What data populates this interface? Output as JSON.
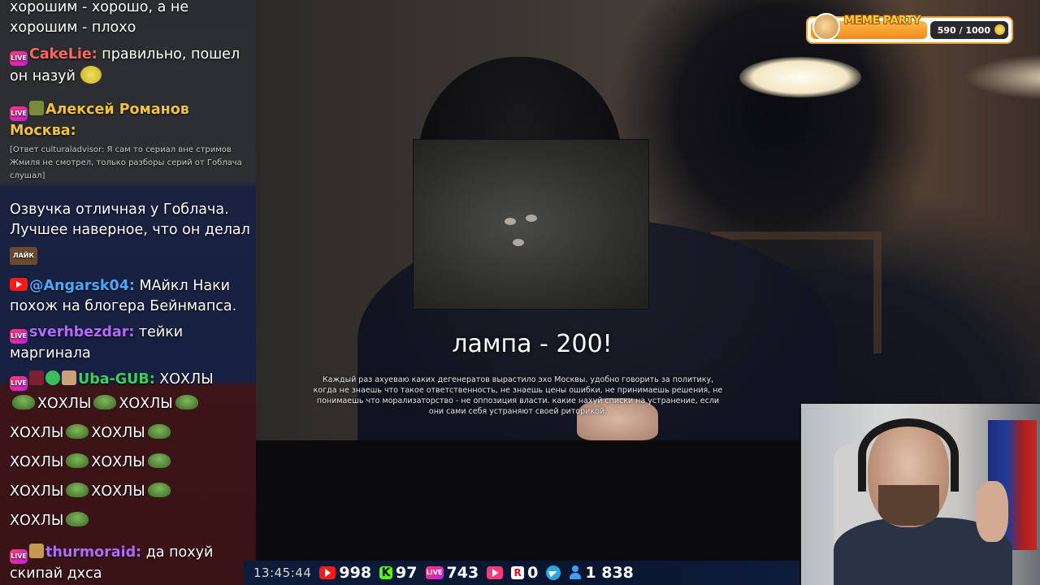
{
  "video": {
    "caption_title": "лампа - 200!",
    "caption_body": "Каждый раз ахуеваю каких дегенератов вырастило эхо Москвы. удобно говорить за политику, когда не знаешь что такое ответственность, не знаешь цены ошибки, не принимаешь решения, не понимаешь что морализаторство - не оппозиция власти. какие нахуй списки на устранение, если они сами себя устраняют своей риторикой."
  },
  "meme_party": {
    "title": "MEME PARTY",
    "progress": "590 / 1000",
    "progress_fraction": 0.59,
    "icon": "doge-icon"
  },
  "chat": {
    "messages": [
      {
        "text": "хорошим - хорошо, а не хорошим - плохо"
      },
      {
        "platform": "live",
        "user": "CakeLie:",
        "text": " правильно, пошел он назуй",
        "emote": "smile-emote"
      },
      {
        "platform": "live",
        "user": "Алексей Романов Москва:",
        "reply": "[Ответ culturaladvisor: Я сам то сериал вне стримов Жмиля не смотрел, только разборы серий от Гоблача слушал]"
      },
      {
        "text": "Озвучка отличная у Гоблача. Лучшее наверное, что он делал",
        "emote": "ЛАЙК"
      },
      {
        "platform": "youtube",
        "user": "@Angarsk04:",
        "text": " МАйкл Наки похож на блогера Бейнмапса."
      },
      {
        "platform": "live",
        "user": "sverhbezdar:",
        "text": " тейки маргинала"
      },
      {
        "platform": "live",
        "user": "Uba-GUB:",
        "text": " ХОХЛЫ",
        "lines": [
          "ХОХЛЫ",
          "ХОХЛЫ",
          "ХОХЛЫ",
          "ХОХЛЫ",
          "ХОХЛЫ",
          "ХОХЛЫ",
          "ХОХЛЫ",
          "ХОХЛЫ",
          "ХОХЛЫ"
        ]
      },
      {
        "platform": "live",
        "user": "thurmoraid:",
        "text": " да похуй скипай дхса"
      }
    ]
  },
  "status": {
    "time": "13:45:44",
    "youtube": "998",
    "kick": "97",
    "live": "743",
    "vk": "",
    "rutube": "0",
    "viewers": "1 838",
    "kick_letter": "K",
    "r_letter": "R",
    "live_label": "LIVE"
  }
}
